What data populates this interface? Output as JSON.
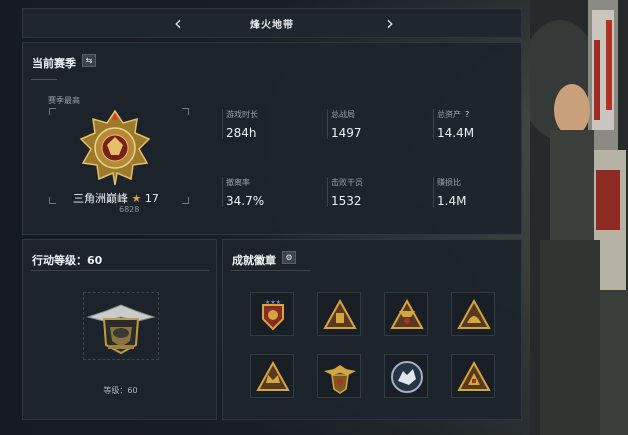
{
  "header": {
    "title": "烽火地带"
  },
  "season": {
    "title": "当前赛季",
    "switch_icon": "swap-icon",
    "high_label": "赛季最高",
    "rank_name": "三角洲巅峰",
    "rank_star": "★",
    "rank_level": "17",
    "rank_score": "6828",
    "stats": [
      {
        "label": "游戏时长",
        "value": "284h"
      },
      {
        "label": "总战局",
        "value": "1497"
      },
      {
        "label": "总资产",
        "value": "14.4M",
        "help": "?"
      },
      {
        "label": "撤离率",
        "value": "34.7%"
      },
      {
        "label": "击败干员",
        "value": "1532"
      },
      {
        "label": "赚损比",
        "value": "1.4M"
      }
    ]
  },
  "action": {
    "title": "行动等级：60",
    "level_text": "等级：60"
  },
  "achievements": {
    "title": "成就徽章",
    "settings_icon": "gear-icon",
    "badges": [
      {
        "name": "shield-star-badge"
      },
      {
        "name": "triangle-card-badge"
      },
      {
        "name": "triangle-skull-badge"
      },
      {
        "name": "triangle-helmet-badge"
      },
      {
        "name": "triangle-crown-badge"
      },
      {
        "name": "eagle-crest-badge"
      },
      {
        "name": "wolf-circle-badge"
      },
      {
        "name": "triangle-flag-badge"
      }
    ]
  },
  "colors": {
    "gold": "#d4a640",
    "panel": "#1e242b",
    "accent_red": "#a8322a"
  }
}
